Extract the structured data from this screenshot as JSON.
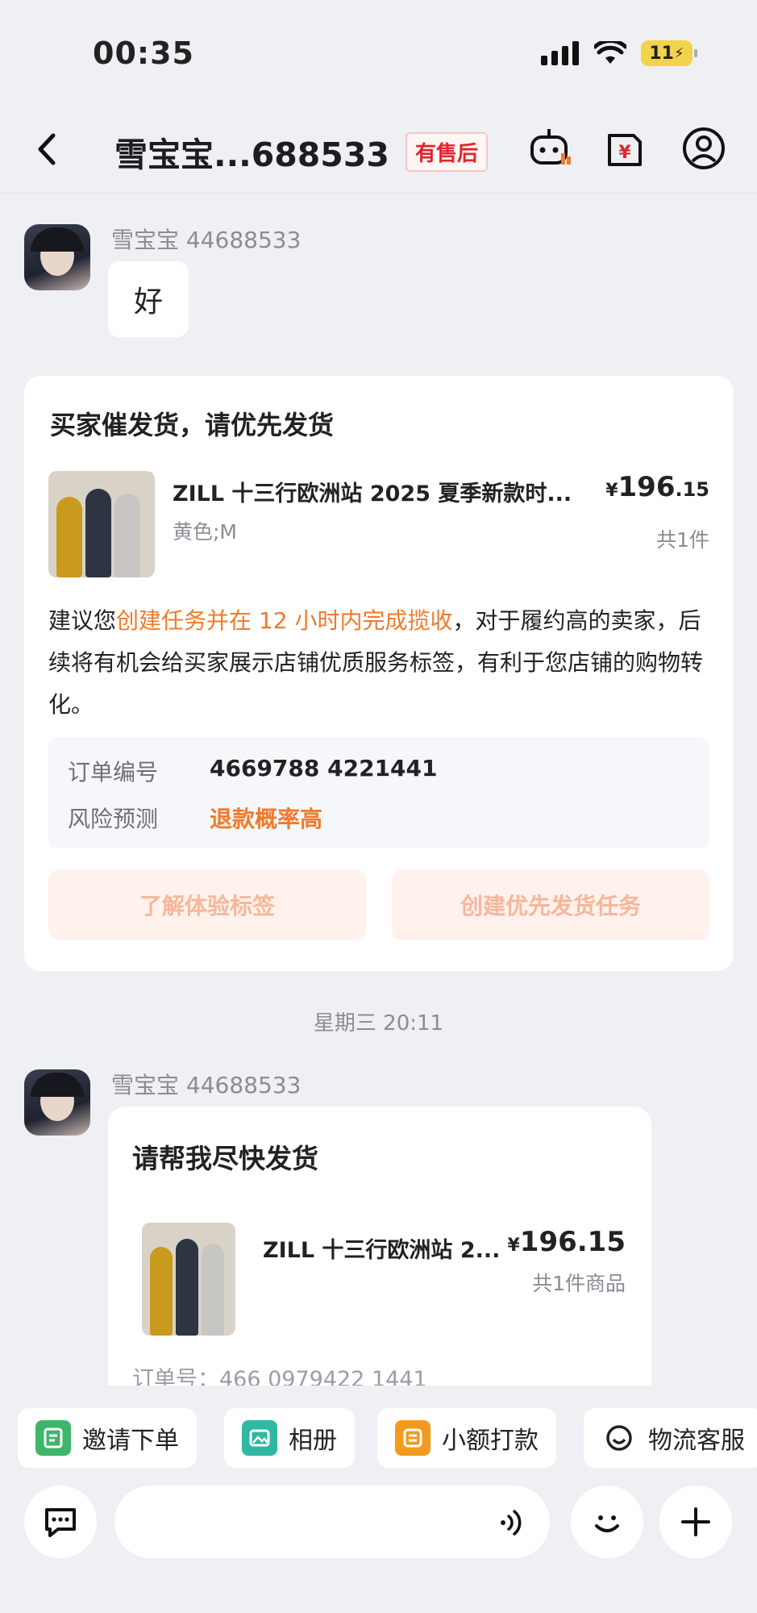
{
  "status_bar": {
    "time": "00:35",
    "battery": "11"
  },
  "nav": {
    "title": "雪宝宝...688533",
    "badge": "有售后"
  },
  "messages": [
    {
      "sender": "雪宝宝 44688533",
      "text": "好"
    }
  ],
  "system_card": {
    "title": "买家催发货，请优先发货",
    "product": {
      "name": "ZILL 十三行欧洲站 2025 夏季新款时...",
      "spec": "黄色;M",
      "price_currency": "¥",
      "price_int": "196",
      "price_dec": ".15",
      "qty": "共1件"
    },
    "desc_prefix": "建议您",
    "desc_highlight": "创建任务并在 12 小时内完成揽收",
    "desc_suffix": "，对于履约高的卖家，后续将有机会给买家展示店铺优质服务标签，有利于您店铺的购物转化。",
    "order_label": "订单编号",
    "order_value": "4669788 4221441",
    "risk_label": "风险预测",
    "risk_value": "退款概率高",
    "btn_learn": "了解体验标签",
    "btn_create": "创建优先发货任务"
  },
  "timestamp": "星期三 20:11",
  "buyer_message": {
    "sender": "雪宝宝 44688533",
    "title": "请帮我尽快发货",
    "product_name": "ZILL 十三行欧洲站 2...",
    "price_currency": "¥",
    "price": "196.15",
    "qty": "共1件商品",
    "order": "订单号：466 0979422 1441"
  },
  "quick_actions": [
    {
      "label": "邀请下单",
      "icon": "invite-order-icon",
      "color": "#3fb56b"
    },
    {
      "label": "相册",
      "icon": "album-icon",
      "color": "#2fb8a3"
    },
    {
      "label": "小额打款",
      "icon": "payment-icon",
      "color": "#f39a1e"
    },
    {
      "label": "物流客服",
      "icon": "logistics-service-icon",
      "color": "#222222"
    }
  ],
  "input": {
    "placeholder": ""
  },
  "colors": {
    "accent_orange": "#f07a2a",
    "badge_red": "#e0252e",
    "background": "#eef0f4"
  }
}
